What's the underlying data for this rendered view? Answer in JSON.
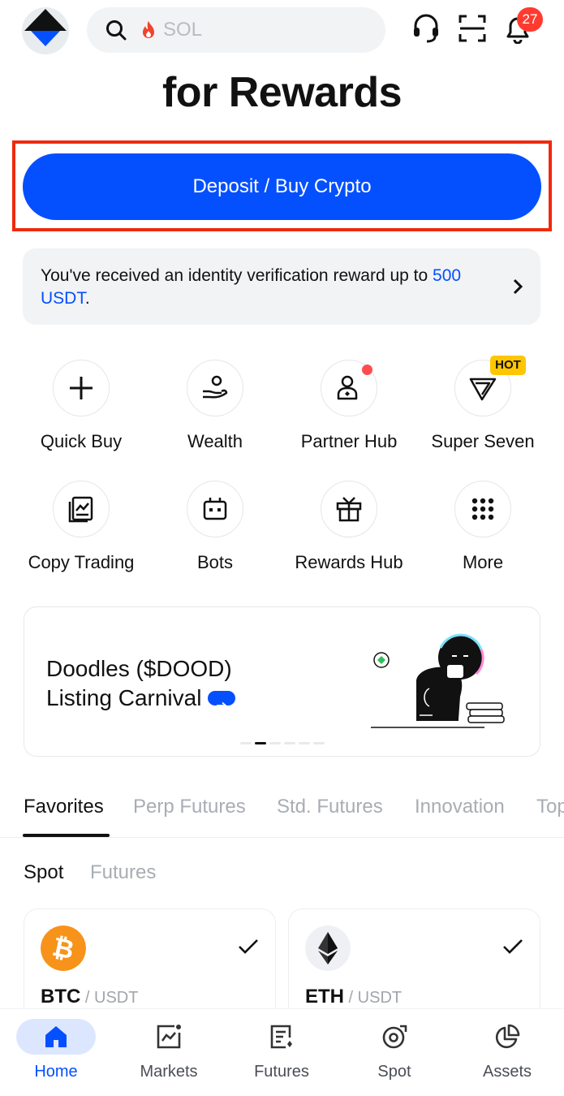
{
  "header": {
    "search_placeholder": "SOL",
    "notification_count": "27"
  },
  "hero": {
    "title": "for Rewards"
  },
  "deposit": {
    "label": "Deposit / Buy Crypto"
  },
  "notice": {
    "text": "You've received an identity verification reward up to ",
    "link_text": "500 USDT",
    "suffix": "."
  },
  "quick_actions": [
    {
      "label": "Quick Buy",
      "icon": "plus-icon"
    },
    {
      "label": "Wealth",
      "icon": "wealth-icon"
    },
    {
      "label": "Partner Hub",
      "icon": "partner-hub-icon"
    },
    {
      "label": "Super Seven",
      "icon": "super-seven-icon",
      "badge": "HOT"
    },
    {
      "label": "Copy Trading",
      "icon": "copy-trading-icon"
    },
    {
      "label": "Bots",
      "icon": "bot-icon"
    },
    {
      "label": "Rewards Hub",
      "icon": "gift-icon"
    },
    {
      "label": "More",
      "icon": "grid-dots-icon"
    }
  ],
  "banner": {
    "line1": "Doodles ($DOOD)",
    "line2": "Listing Carnival"
  },
  "market_tabs": [
    "Favorites",
    "Perp Futures",
    "Std. Futures",
    "Innovation",
    "Top"
  ],
  "sub_tabs": [
    "Spot",
    "Futures"
  ],
  "favorites": [
    {
      "symbol": "BTC",
      "quote": " / USDT"
    },
    {
      "symbol": "ETH",
      "quote": " / USDT"
    }
  ],
  "bottom_nav": [
    {
      "label": "Home",
      "icon": "home-icon"
    },
    {
      "label": "Markets",
      "icon": "markets-icon"
    },
    {
      "label": "Futures",
      "icon": "futures-icon"
    },
    {
      "label": "Spot",
      "icon": "spot-icon"
    },
    {
      "label": "Assets",
      "icon": "assets-icon"
    }
  ],
  "colors": {
    "accent": "#0450fe",
    "highlight_frame": "#ee2a0e",
    "badge": "#ff3b30",
    "hot": "#ffc600"
  }
}
